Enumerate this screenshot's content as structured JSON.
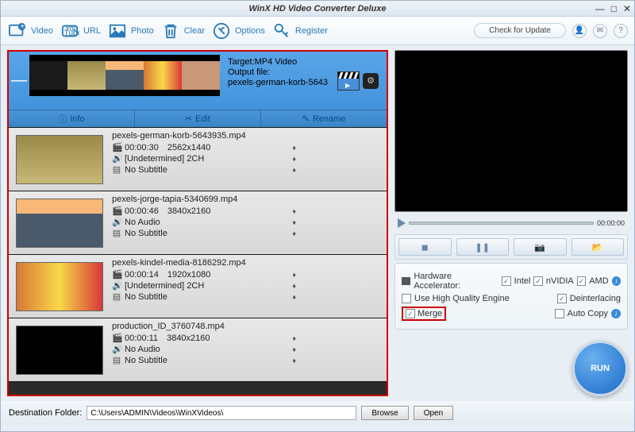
{
  "title": "WinX HD Video Converter Deluxe",
  "toolbar": {
    "video": "Video",
    "url": "URL",
    "photo": "Photo",
    "clear": "Clear",
    "options": "Options",
    "register": "Register",
    "update": "Check for Update"
  },
  "selected": {
    "target_label": "Target:MP4 Video",
    "output_label": "Output file:",
    "output_file": "pexels-german-korb-5643",
    "info": "Info",
    "edit": "Edit",
    "rename": "Rename"
  },
  "files": [
    {
      "name": "pexels-german-korb-5643935.mp4",
      "dur": "00:00:30",
      "res": "2562x1440",
      "audio": "[Undetermined] 2CH",
      "sub": "No Subtitle"
    },
    {
      "name": "pexels-jorge-tapia-5340699.mp4",
      "dur": "00:00:46",
      "res": "3840x2160",
      "audio": "No Audio",
      "sub": "No Subtitle"
    },
    {
      "name": "pexels-kindel-media-8186292.mp4",
      "dur": "00:00:14",
      "res": "1920x1080",
      "audio": "[Undetermined] 2CH",
      "sub": "No Subtitle"
    },
    {
      "name": "production_ID_3760748.mp4",
      "dur": "00:00:11",
      "res": "3840x2160",
      "audio": "No Audio",
      "sub": "No Subtitle"
    }
  ],
  "preview": {
    "time": "00:00:00"
  },
  "opts": {
    "hw_label": "Hardware Accelerator:",
    "intel": "Intel",
    "nvidia": "nVIDIA",
    "amd": "AMD",
    "hq": "Use High Quality Engine",
    "deint": "Deinterlacing",
    "merge": "Merge",
    "autocopy": "Auto Copy"
  },
  "run": "RUN",
  "dest": {
    "label": "Destination Folder:",
    "path": "C:\\Users\\ADMIN\\Videos\\WinXVideos\\",
    "browse": "Browse",
    "open": "Open"
  }
}
